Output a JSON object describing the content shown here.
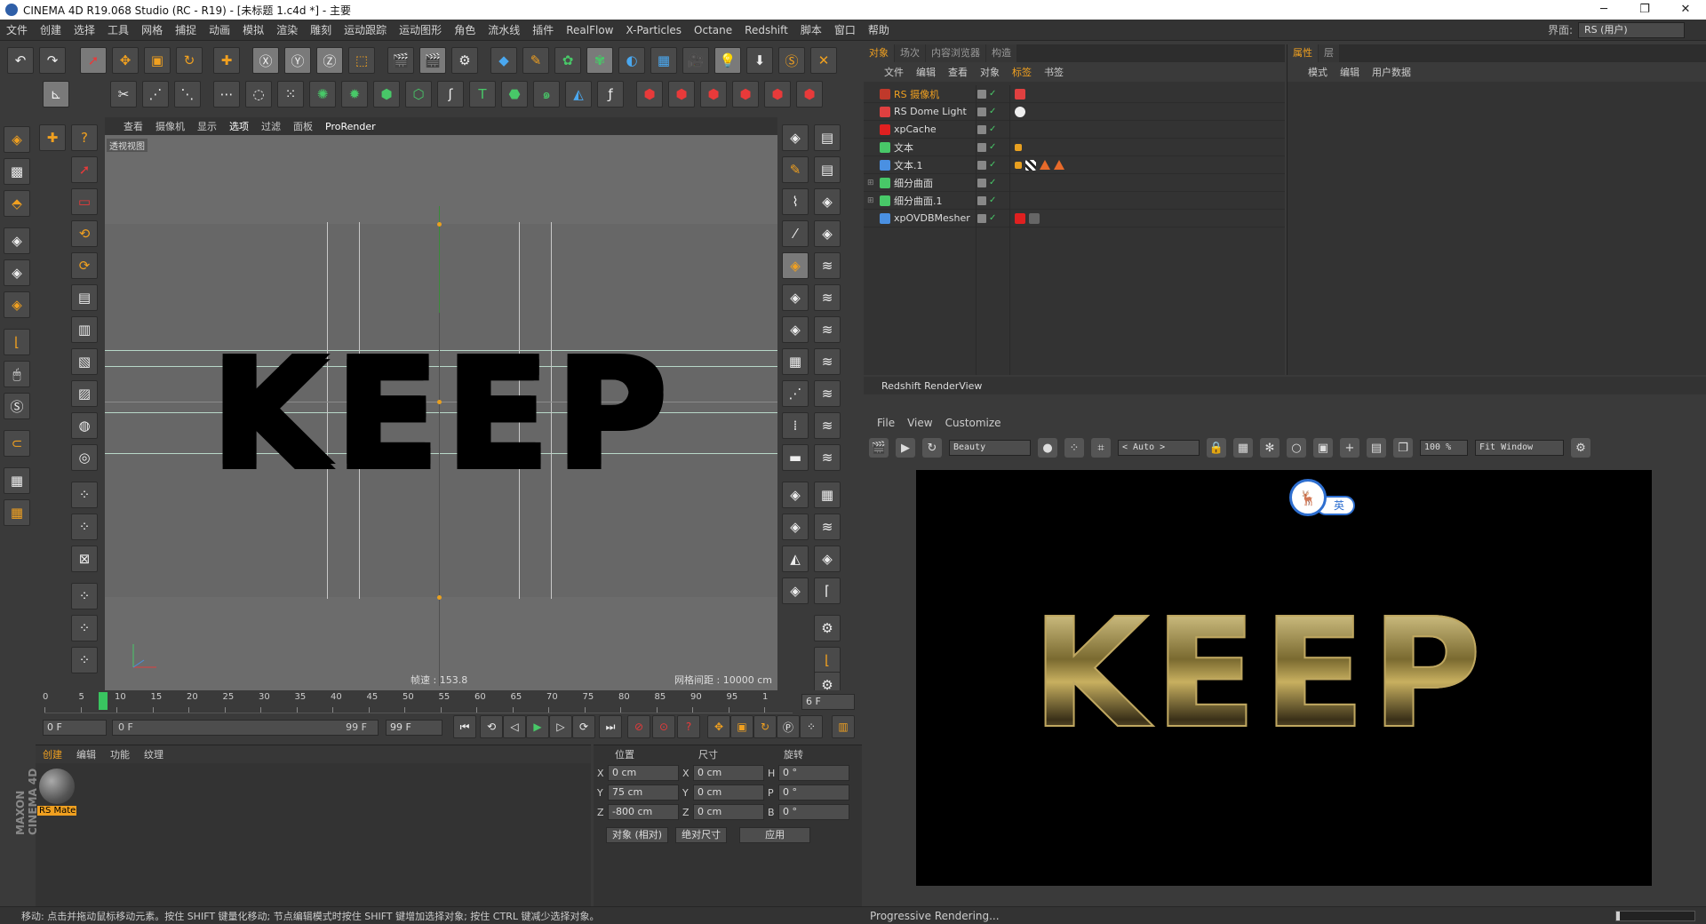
{
  "window": {
    "title": "CINEMA 4D R19.068 Studio (RC - R19) - [未标题 1.c4d *] - 主要",
    "min": "─",
    "max": "❐",
    "close": "✕"
  },
  "menu": [
    "文件",
    "创建",
    "选择",
    "工具",
    "网格",
    "捕捉",
    "动画",
    "模拟",
    "渲染",
    "雕刻",
    "运动跟踪",
    "运动图形",
    "角色",
    "流水线",
    "插件",
    "RealFlow",
    "X-Particles",
    "Octane",
    "Redshift",
    "脚本",
    "窗口",
    "帮助"
  ],
  "layout": {
    "label": "界面:",
    "value": "RS (用户)"
  },
  "viewport": {
    "menu": [
      "查看",
      "摄像机",
      "显示",
      "选项",
      "过滤",
      "面板",
      "ProRender"
    ],
    "active_menu": "选项",
    "label": "透视视图",
    "text": "KEEP",
    "fps": "帧速 : 153.8",
    "grid": "网格间距 : 10000 cm"
  },
  "timeline": {
    "ticks": [
      "0",
      "5",
      "10",
      "15",
      "20",
      "25",
      "30",
      "35",
      "40",
      "45",
      "50",
      "55",
      "60",
      "65",
      "70",
      "75",
      "80",
      "85",
      "90",
      "95",
      "1"
    ],
    "current": "6 F",
    "start": "0 F",
    "range_start": "0 F",
    "range_end": "99 F",
    "end": "99 F"
  },
  "material_panel": {
    "menu": [
      "创建",
      "编辑",
      "功能",
      "纹理"
    ],
    "material_name": "RS Mate"
  },
  "coords": {
    "headers": [
      "位置",
      "尺寸",
      "旋转"
    ],
    "rows": [
      {
        "axis1": "X",
        "pos": "0 cm",
        "axis2": "X",
        "size": "0 cm",
        "axis3": "H",
        "rot": "0 °"
      },
      {
        "axis1": "Y",
        "pos": "75 cm",
        "axis2": "Y",
        "size": "0 cm",
        "axis3": "P",
        "rot": "0 °"
      },
      {
        "axis1": "Z",
        "pos": "-800 cm",
        "axis2": "Z",
        "size": "0 cm",
        "axis3": "B",
        "rot": "0 °"
      }
    ],
    "mode": "对象 (相对)",
    "size_mode": "绝对尺寸",
    "apply": "应用"
  },
  "brand": "MAXON CINEMA 4D",
  "object_panel": {
    "tabs": [
      "对象",
      "场次",
      "内容浏览器",
      "构造"
    ],
    "menu": [
      "文件",
      "编辑",
      "查看",
      "对象",
      "标签",
      "书签"
    ],
    "objects": [
      {
        "name": "RS 摄像机",
        "color": "#c0392b",
        "selected": true
      },
      {
        "name": "RS Dome Light",
        "color": "#e04040",
        "selected": false
      },
      {
        "name": "xpCache",
        "color": "#e02020",
        "selected": false
      },
      {
        "name": "文本",
        "color": "#48c868",
        "selected": false
      },
      {
        "name": "文本.1",
        "color": "#4a90e2",
        "selected": false
      },
      {
        "name": "细分曲面",
        "color": "#48c868",
        "selected": false
      },
      {
        "name": "细分曲面.1",
        "color": "#48c868",
        "selected": false
      },
      {
        "name": "xpOVDBMesher",
        "color": "#4a90e2",
        "selected": false
      }
    ]
  },
  "attr_panel": {
    "tabs": [
      "属性",
      "层"
    ],
    "menu": [
      "模式",
      "编辑",
      "用户数据"
    ]
  },
  "renderview": {
    "title": "Redshift RenderView",
    "menu": [
      "File",
      "View",
      "Customize"
    ],
    "aov": "Beauty",
    "auto": "< Auto >",
    "zoom": "100 %",
    "fit": "Fit Window",
    "render_text": "KEEP",
    "badge_lang": "英",
    "badge_icon": "deer-logo"
  },
  "status": {
    "message": "移动: 点击并拖动鼠标移动元素。按住 SHIFT 键量化移动; 节点编辑模式时按住 SHIFT 键增加选择对象; 按住 CTRL 键减少选择对象。",
    "progress_text": "Progressive Rendering...",
    "progress": 0.05
  }
}
